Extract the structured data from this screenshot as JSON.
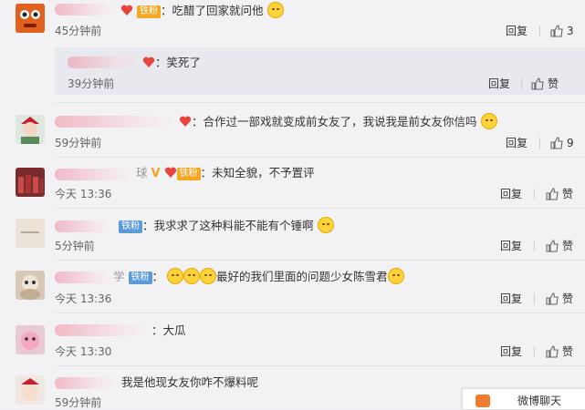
{
  "comments": [
    {
      "text": "吃醋了回家就问他",
      "time": "45分钟前",
      "reply": "回复",
      "likes": "3",
      "badge": "铁粉",
      "sub_reply": {
        "text": "笑死了",
        "time": "39分钟前",
        "reply": "回复",
        "like": "赞"
      }
    },
    {
      "text": "合作过一部戏就变成前女友了，我说我是前女友你信吗",
      "time": "59分钟前",
      "reply": "回复",
      "likes": "9"
    },
    {
      "text": "未知全貌，不予置评",
      "time": "今天 13:36",
      "reply": "回复",
      "like": "赞",
      "badge": "铁粉"
    },
    {
      "text": "我求求了这种料能不能有个锤啊",
      "time": "5分钟前",
      "reply": "回复",
      "like": "赞",
      "badge": "铁粉"
    },
    {
      "text": "最好的我们里面的问题少女陈雪君",
      "time": "今天 13:36",
      "reply": "回复",
      "like": "赞",
      "badge": "铁粉",
      "name_tail": "学"
    },
    {
      "text": "大瓜",
      "time": "今天 13:30",
      "reply": "回复",
      "like": "赞"
    },
    {
      "text": "我是他现女友你咋不爆料呢",
      "time": "59分钟前"
    }
  ],
  "popup": {
    "text": "微博聊天"
  },
  "colors": {
    "vip": "#f7a11a",
    "iron_fan": "#5c9ad8",
    "tag_orange": "#f5a623"
  }
}
